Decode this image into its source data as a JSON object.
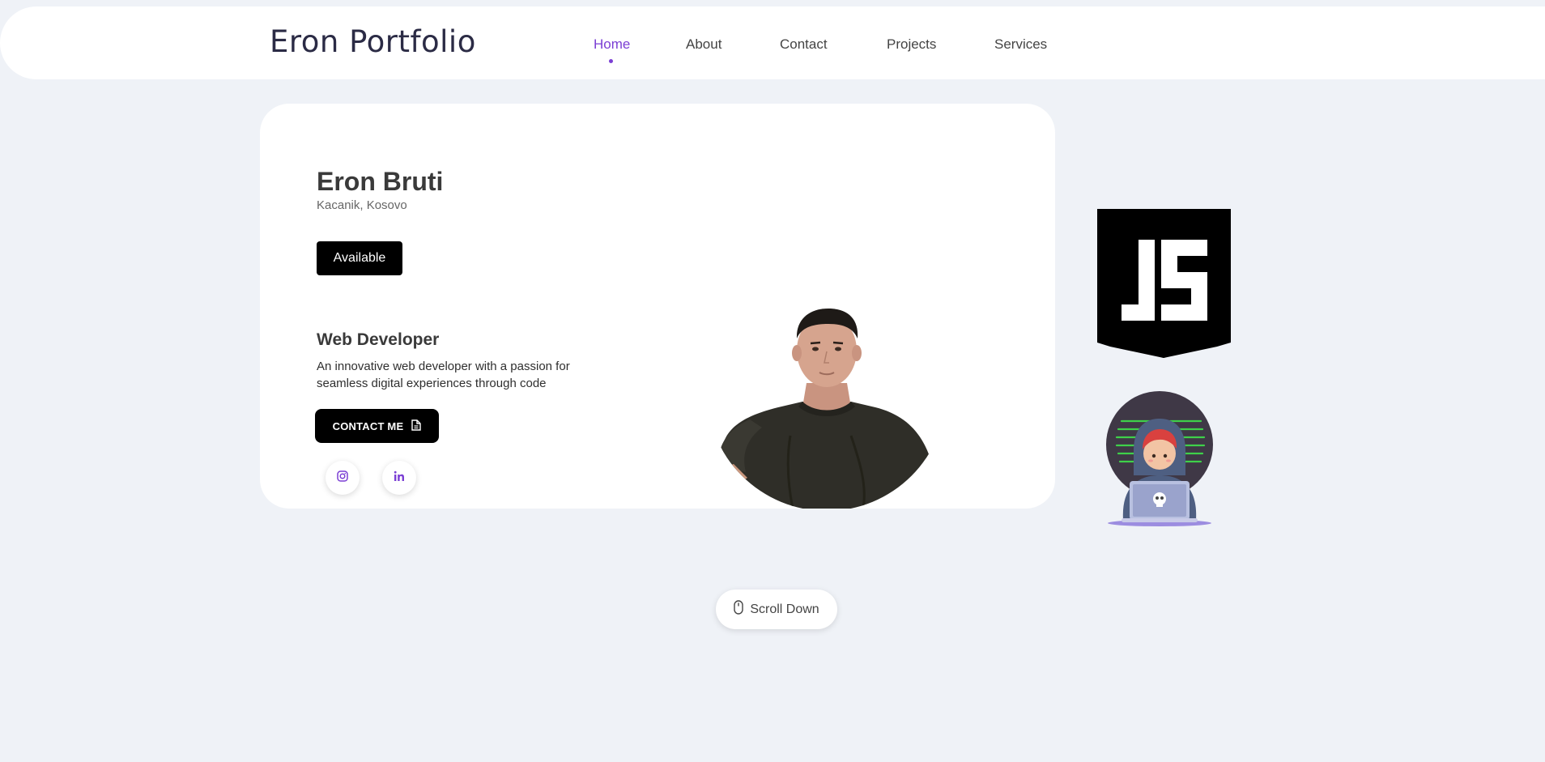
{
  "header": {
    "logo": "Eron Portfolio",
    "nav": [
      "Home",
      "About",
      "Contact",
      "Projects",
      "Services"
    ],
    "active": "Home"
  },
  "hero": {
    "name": "Eron Bruti",
    "location": "Kacanik, Kosovo",
    "status_button": "Available",
    "role": "Web Developer",
    "description": "An innovative web developer with a passion for seamless digital experiences through code",
    "contact_button": "CONTACT ME",
    "socials": [
      {
        "icon": "instagram-icon"
      },
      {
        "icon": "linkedin-icon"
      }
    ]
  },
  "scroll": {
    "label": "Scroll Down",
    "icon": "mouse-icon"
  },
  "colors": {
    "accent": "#7b3fd4",
    "background": "#eff2f7",
    "button": "#000000"
  }
}
